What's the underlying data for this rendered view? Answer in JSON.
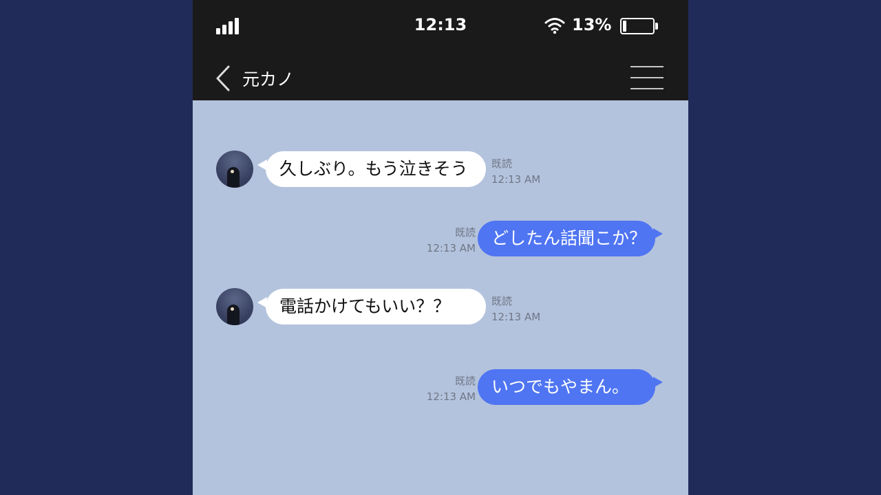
{
  "status_bar": {
    "time": "12:13",
    "battery_percent": "13%",
    "battery_level": 0.13
  },
  "header": {
    "title": "元カノ"
  },
  "icons": {
    "back": "chevron-left-icon",
    "menu": "hamburger-menu-icon",
    "signal": "signal-bars-icon",
    "wifi": "wifi-icon",
    "battery": "battery-icon"
  },
  "colors": {
    "outgoing_bubble": "#4f75f2",
    "incoming_bubble": "#ffffff",
    "chat_background": "#b4c3dd",
    "header_background": "#1a1a1a"
  },
  "messages": [
    {
      "direction": "incoming",
      "text": "久しぶり。もう泣きそう",
      "read_label": "既読",
      "time": "12:13 AM"
    },
    {
      "direction": "outgoing",
      "text": "どしたん話聞こか？",
      "read_label": "既読",
      "time": "12:13 AM"
    },
    {
      "direction": "incoming",
      "text": "電話かけてもいい？？",
      "read_label": "既読",
      "time": "12:13 AM"
    },
    {
      "direction": "outgoing",
      "text": "いつでもやまん。",
      "read_label": "既読",
      "time": "12:13 AM"
    }
  ]
}
